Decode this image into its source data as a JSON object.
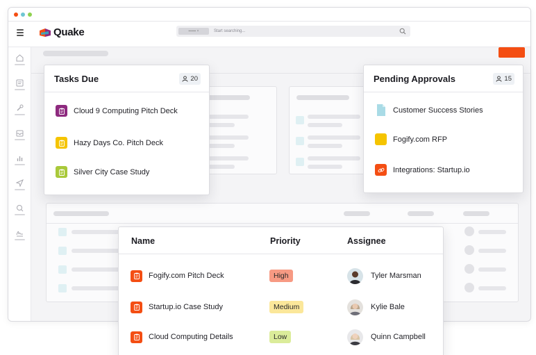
{
  "app": {
    "name": "Quake",
    "search_placeholder": "Start searching..."
  },
  "colors": {
    "accent": "#f44e13",
    "window_close": "#f44e13",
    "window_min": "#6fc6d3",
    "window_max": "#8fd14f"
  },
  "sidebar": {
    "items": [
      {
        "icon": "home-icon"
      },
      {
        "icon": "notes-icon"
      },
      {
        "icon": "wrench-icon"
      },
      {
        "icon": "inbox-icon"
      },
      {
        "icon": "bar-chart-icon"
      },
      {
        "icon": "send-icon"
      },
      {
        "icon": "search-person-icon"
      },
      {
        "icon": "signature-icon"
      }
    ]
  },
  "tasks_due": {
    "title": "Tasks Due",
    "count": "20",
    "items": [
      {
        "label": "Cloud 9 Computing Pitch Deck",
        "color": "#8e2a7f"
      },
      {
        "label": "Hazy Days Co. Pitch Deck",
        "color": "#f5c400"
      },
      {
        "label": "Silver City Case Study",
        "color": "#a9c93a"
      }
    ]
  },
  "pending_approvals": {
    "title": "Pending Approvals",
    "count": "15",
    "items": [
      {
        "label": "Customer Success Stories",
        "icon": "document-icon",
        "color": "#a9dbe6"
      },
      {
        "label": "Fogify.com RFP",
        "icon": "folder-icon",
        "color": "#f5c400"
      },
      {
        "label": "Integrations: Startup.io",
        "icon": "link-icon",
        "color": "#f44e13"
      }
    ]
  },
  "table": {
    "columns": [
      "Name",
      "Priority",
      "Assignee"
    ],
    "rows": [
      {
        "name": "Fogify.com Pitch Deck",
        "priority": "High",
        "priority_color": "#f79a83",
        "assignee": "Tyler Marsman"
      },
      {
        "name": "Startup.io Case Study",
        "priority": "Medium",
        "priority_color": "#fbe79a",
        "assignee": "Kylie Bale"
      },
      {
        "name": "Cloud Computing Details",
        "priority": "Low",
        "priority_color": "#dbec9a",
        "assignee": "Quinn Campbell"
      }
    ]
  }
}
